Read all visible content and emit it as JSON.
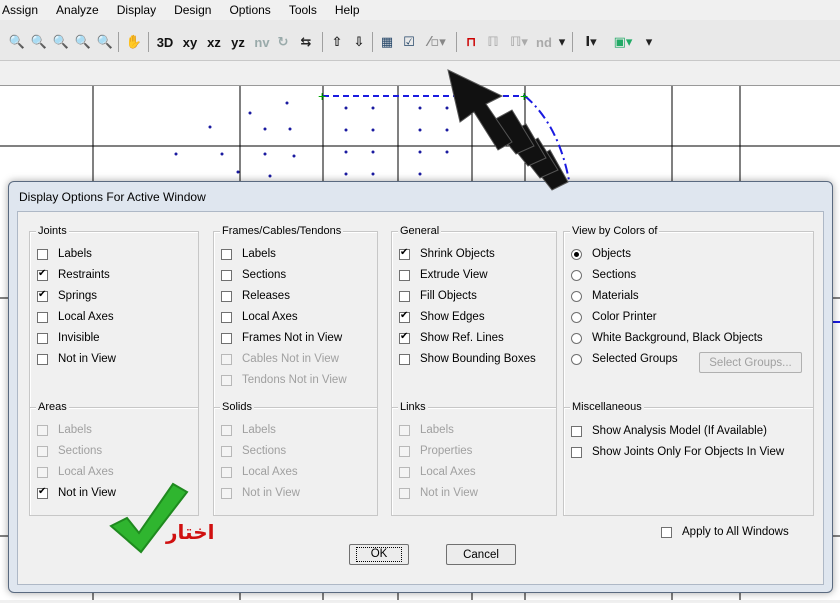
{
  "menu": [
    "Assign",
    "Analyze",
    "Display",
    "Design",
    "Options",
    "Tools",
    "Help"
  ],
  "toolbar": {
    "view_3d": "3D",
    "plane_xy": "xy",
    "plane_xz": "xz",
    "plane_yz": "yz",
    "nv": "nv",
    "nd": "nd"
  },
  "dialog": {
    "title": "Display Options For Active Window",
    "groups": {
      "joints": {
        "title": "Joints",
        "items": [
          {
            "label": "Labels",
            "checked": false,
            "enabled": true
          },
          {
            "label": "Restraints",
            "checked": true,
            "enabled": true
          },
          {
            "label": "Springs",
            "checked": true,
            "enabled": true
          },
          {
            "label": "Local Axes",
            "checked": false,
            "enabled": true
          },
          {
            "label": "Invisible",
            "checked": false,
            "enabled": true
          },
          {
            "label": "Not in View",
            "checked": false,
            "enabled": true
          }
        ]
      },
      "frames": {
        "title": "Frames/Cables/Tendons",
        "items": [
          {
            "label": "Labels",
            "checked": false,
            "enabled": true
          },
          {
            "label": "Sections",
            "checked": false,
            "enabled": true
          },
          {
            "label": "Releases",
            "checked": false,
            "enabled": true
          },
          {
            "label": "Local Axes",
            "checked": false,
            "enabled": true
          },
          {
            "label": "Frames Not in View",
            "checked": false,
            "enabled": true
          },
          {
            "label": "Cables Not in View",
            "checked": false,
            "enabled": false
          },
          {
            "label": "Tendons Not in View",
            "checked": false,
            "enabled": false
          }
        ]
      },
      "general": {
        "title": "General",
        "items": [
          {
            "label": "Shrink Objects",
            "checked": true,
            "enabled": true
          },
          {
            "label": "Extrude View",
            "checked": false,
            "enabled": true
          },
          {
            "label": "Fill Objects",
            "checked": false,
            "enabled": true
          },
          {
            "label": "Show Edges",
            "checked": true,
            "enabled": true
          },
          {
            "label": "Show Ref. Lines",
            "checked": true,
            "enabled": true
          },
          {
            "label": "Show Bounding Boxes",
            "checked": false,
            "enabled": true
          }
        ]
      },
      "view_by_colors": {
        "title": "View by Colors of",
        "items": [
          {
            "label": "Objects",
            "selected": true
          },
          {
            "label": "Sections",
            "selected": false
          },
          {
            "label": "Materials",
            "selected": false
          },
          {
            "label": "Color Printer",
            "selected": false
          },
          {
            "label": "White Background, Black Objects",
            "selected": false
          },
          {
            "label": "Selected Groups",
            "selected": false
          }
        ],
        "select_groups_button": "Select Groups..."
      },
      "areas": {
        "title": "Areas",
        "items": [
          {
            "label": "Labels",
            "checked": false,
            "enabled": false
          },
          {
            "label": "Sections",
            "checked": false,
            "enabled": false
          },
          {
            "label": "Local Axes",
            "checked": false,
            "enabled": false
          },
          {
            "label": "Not in View",
            "checked": true,
            "enabled": true
          }
        ]
      },
      "solids": {
        "title": "Solids",
        "items": [
          {
            "label": "Labels",
            "checked": false,
            "enabled": false
          },
          {
            "label": "Sections",
            "checked": false,
            "enabled": false
          },
          {
            "label": "Local Axes",
            "checked": false,
            "enabled": false
          },
          {
            "label": "Not in View",
            "checked": false,
            "enabled": false
          }
        ]
      },
      "links": {
        "title": "Links",
        "items": [
          {
            "label": "Labels",
            "checked": false,
            "enabled": false
          },
          {
            "label": "Properties",
            "checked": false,
            "enabled": false
          },
          {
            "label": "Local Axes",
            "checked": false,
            "enabled": false
          },
          {
            "label": "Not in View",
            "checked": false,
            "enabled": false
          }
        ]
      },
      "misc": {
        "title": "Miscellaneous",
        "items": [
          {
            "label": "Show Analysis Model  (If Available)",
            "checked": false,
            "enabled": true
          },
          {
            "label": "Show Joints Only For Objects In View",
            "checked": false,
            "enabled": true
          }
        ]
      }
    },
    "apply_all": {
      "label": "Apply to All Windows",
      "checked": false
    },
    "ok_label": "OK",
    "cancel_label": "Cancel"
  },
  "annotation": {
    "arabic_text": "اختار",
    "arrow_color": "#111111",
    "check_color": "#2fb52f",
    "text_color": "#d01010"
  }
}
